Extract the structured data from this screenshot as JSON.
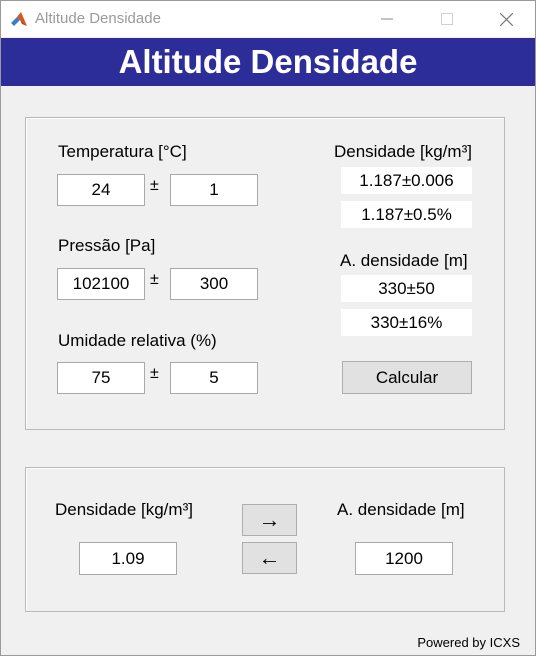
{
  "window": {
    "title": "Altitude Densidade",
    "colors": {
      "banner": "#2d2d9a",
      "background": "#f0f0f0"
    }
  },
  "banner": {
    "title": "Altitude Densidade"
  },
  "inputs": {
    "temperature": {
      "label": "Temperatura [°C]",
      "value": "24",
      "uncertainty": "1"
    },
    "pressure": {
      "label": "Pressão [Pa]",
      "value": "102100",
      "uncertainty": "300"
    },
    "humidity": {
      "label": "Umidade relativa (%)",
      "value": "75",
      "uncertainty": "5"
    },
    "pm_symbol": "±"
  },
  "results": {
    "density_label": "Densidade [kg/m³]",
    "density_abs": "1.187±0.006",
    "density_rel": "1.187±0.5%",
    "altitude_label": "A. densidade [m]",
    "altitude_abs": "330±50",
    "altitude_rel": "330±16%",
    "calculate_button": "Calcular"
  },
  "converter": {
    "density_label": "Densidade [kg/m³]",
    "density_value": "1.09",
    "altitude_label": "A. densidade [m]",
    "altitude_value": "1200",
    "to_altitude_arrow": "→",
    "to_density_arrow": "←"
  },
  "footer": {
    "text": "Powered by ICXS"
  }
}
